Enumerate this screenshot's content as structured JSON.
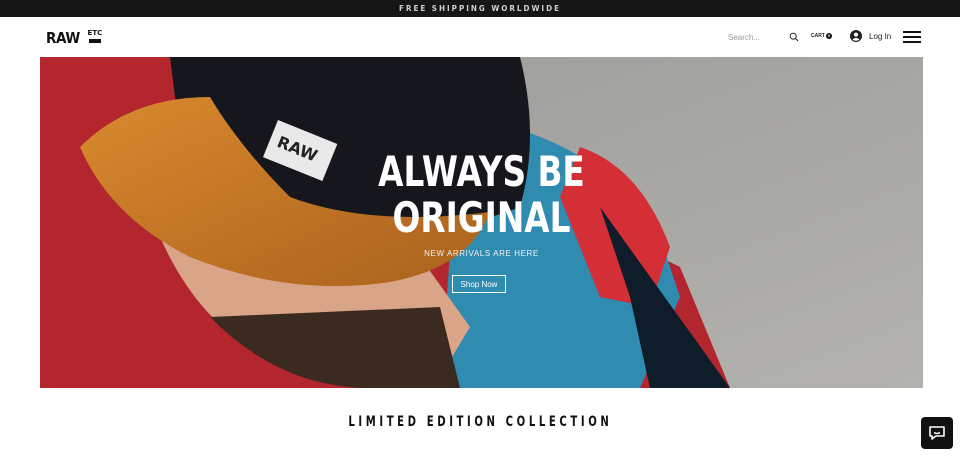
{
  "announcement": {
    "text": "FREE SHIPPING WORLDWIDE"
  },
  "header": {
    "logo": {
      "primary": "RAW",
      "secondary": "ETC"
    },
    "search": {
      "placeholder": "Search..."
    },
    "cart": {
      "label": "CART",
      "count": "0"
    },
    "login": {
      "label": "Log In"
    }
  },
  "hero": {
    "title_line1": "ALWAYS BE",
    "title_line2": "ORIGINAL",
    "subtitle": "NEW ARRIVALS ARE HERE",
    "cta": "Shop Now"
  },
  "collection": {
    "title": "LIMITED EDITION COLLECTION"
  },
  "colors": {
    "topbar": "#161616",
    "accent": "#111111",
    "text_on_image": "#ffffff"
  },
  "icons": [
    "search-icon",
    "avatar-icon",
    "menu-icon",
    "chat-icon"
  ]
}
